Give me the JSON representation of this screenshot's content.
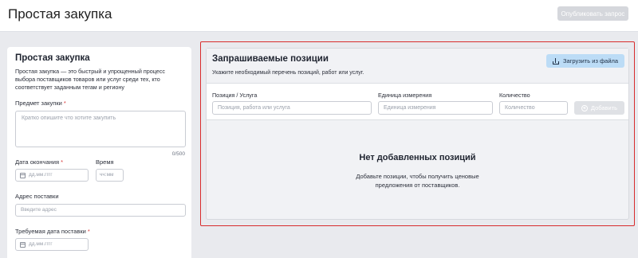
{
  "header": {
    "title": "Простая закупка",
    "publish_label": "Опубликовать запрос"
  },
  "left": {
    "title": "Простая закупка",
    "description": "Простая закупка — это быстрый и упрощенный процесс выбора поставщиков товаров или услуг среди тех, кто соответствует заданным тегам и региону",
    "subject_label": "Предмет закупки",
    "subject_placeholder": "Кратко опишите что хотите закупить",
    "subject_counter": "0/500",
    "end_date_label": "Дата окончания",
    "date_placeholder": "дд.мм.гггг",
    "time_label": "Время",
    "time_placeholder": "чч:мм",
    "address_label": "Адрес поставки",
    "address_placeholder": "Введите адрес",
    "delivery_date_label": "Требуемая дата поставки",
    "required_mark": "*"
  },
  "positions": {
    "title": "Запрашиваемые позиции",
    "subtitle": "Укажите необходимый перечень позиций, работ или услуг.",
    "upload_label": "Загрузить из файла",
    "position_label": "Позиция / Услуга",
    "position_placeholder": "Позиция, работа или услуга",
    "unit_label": "Единица измерения",
    "unit_placeholder": "Единица измерения",
    "qty_label": "Количество",
    "qty_placeholder": "Количество",
    "add_label": "Добавить",
    "empty_title": "Нет добавленных позиций",
    "empty_desc_line1": "Добавьте позиции, чтобы получить ценовые",
    "empty_desc_line2": "предложения от поставщиков."
  },
  "colors": {
    "highlight": "#d82c2c",
    "upload_button": "#bcdcf6",
    "disabled_button": "#d5d7dc"
  }
}
